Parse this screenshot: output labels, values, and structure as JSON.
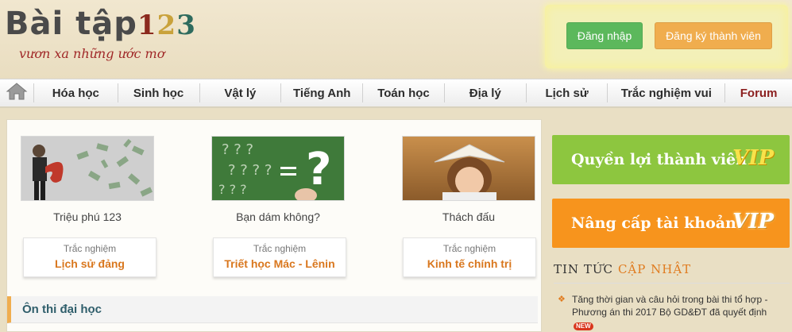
{
  "header": {
    "logo_word": "Bài tập",
    "logo_digits": [
      "1",
      "2",
      "3"
    ],
    "slogan": "vươn xa những ước mơ",
    "login_label": "Đăng nhập",
    "register_label": "Đăng ký thành viên"
  },
  "nav": {
    "home_icon": "home-icon",
    "items": [
      "Hóa học",
      "Sinh học",
      "Vật lý",
      "Tiếng Anh",
      "Toán học",
      "Địa lý",
      "Lịch sử",
      "Trắc nghiệm vui",
      "Forum"
    ]
  },
  "promos": [
    {
      "title": "Triệu phú 123",
      "kind": "Trắc nghiệm",
      "name": "Lịch sử đảng"
    },
    {
      "title": "Bạn dám không?",
      "kind": "Trắc nghiệm",
      "name": "Triết học Mác - Lênin"
    },
    {
      "title": "Thách đấu",
      "kind": "Trắc nghiệm",
      "name": "Kinh tế chính trị"
    }
  ],
  "section": {
    "title": "Ôn thi đại học"
  },
  "sidebar": {
    "vip1_label": "Quyền lợi thành viên",
    "vip2_label": "Nâng cấp tài khoản",
    "vip_badge": "VIP",
    "news_head_a": "TIN TỨC",
    "news_head_b": "CẬP NHẬT",
    "news_items": [
      {
        "text": "Tăng thời gian và câu hỏi trong bài thi tổ hợp - Phương án thi 2017 Bộ GD&ĐT đã quyết định",
        "badge": "NEW"
      }
    ]
  },
  "colors": {
    "accent_orange": "#f0ad4e",
    "accent_green": "#5cb85c",
    "vip_green": "#8dc63f",
    "vip_orange": "#f7941d",
    "link_orange": "#d9771e"
  }
}
